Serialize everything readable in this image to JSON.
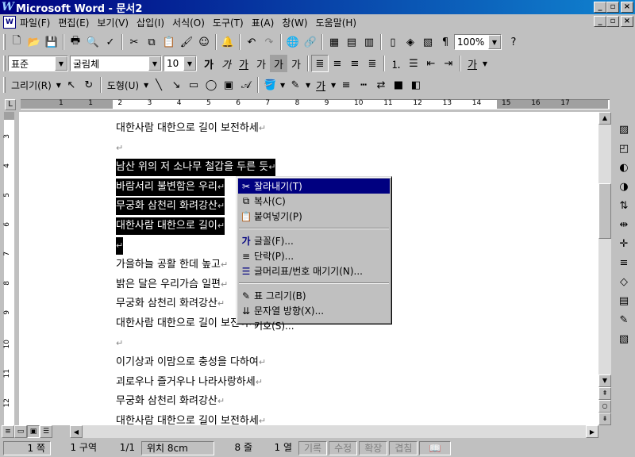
{
  "window": {
    "title": "Microsoft Word - 문서2",
    "minimize": "_",
    "restore": "▫",
    "close": "×"
  },
  "menu": [
    "파일(F)",
    "편집(E)",
    "보기(V)",
    "삽입(I)",
    "서식(O)",
    "도구(T)",
    "표(A)",
    "창(W)",
    "도움말(H)"
  ],
  "standard_toolbar": {
    "zoom": "100%"
  },
  "format_toolbar": {
    "style": "표준",
    "font": "굴림체",
    "size": "10"
  },
  "drawing_toolbar": {
    "draw_label": "그리기(R)",
    "autoshape_label": "도형(U)"
  },
  "ruler": {
    "h_numbers": [
      "1",
      "1",
      "2",
      "3",
      "4",
      "5",
      "6",
      "7",
      "8",
      "9",
      "10",
      "11",
      "12",
      "13",
      "14",
      "15",
      "16",
      "17"
    ],
    "v_numbers": [
      "3",
      "4",
      "5",
      "6",
      "7",
      "8",
      "9",
      "10",
      "11",
      "12",
      "13"
    ]
  },
  "document": {
    "lines": [
      {
        "text": "대한사람 대한으로 길이 보전하세",
        "selected": false
      },
      {
        "text": "",
        "selected": false
      },
      {
        "text": "남산 위의 저 소나무 철갑을 두른 듯",
        "selected": true
      },
      {
        "text": "바람서리 불변함은 우리",
        "selected": true
      },
      {
        "text": "무궁화 삼천리 화려강산",
        "selected": true
      },
      {
        "text": "대한사람 대한으로 길이",
        "selected": true
      },
      {
        "text": "",
        "selected": true
      },
      {
        "text": "가을하늘 공활 한데 높고",
        "selected": false
      },
      {
        "text": "밝은 달은 우리가슴 일편",
        "selected": false
      },
      {
        "text": "무궁화 삼천리 화려강산",
        "selected": false
      },
      {
        "text": "대한사람 대한으로 길이 보전하세",
        "selected": false
      },
      {
        "text": "",
        "selected": false
      },
      {
        "text": "이기상과 이맘으로 충성을 다하여",
        "selected": false
      },
      {
        "text": "괴로우나 즐거우나 나라사랑하세",
        "selected": false
      },
      {
        "text": "무궁화 삼천리 화려강산",
        "selected": false
      },
      {
        "text": "대한사람 대한으로 길이 보전하세",
        "selected": false
      }
    ],
    "para_mark": "↵"
  },
  "context_menu": {
    "group1": [
      {
        "label": "잘라내기(T)",
        "icon": "cut-icon"
      },
      {
        "label": "복사(C)",
        "icon": "copy-icon"
      },
      {
        "label": "붙여넣기(P)",
        "icon": "paste-icon"
      }
    ],
    "group2": [
      {
        "label": "글꼴(F)...",
        "icon": "font-icon"
      },
      {
        "label": "단락(P)...",
        "icon": "paragraph-icon"
      },
      {
        "label": "글머리표/번호 매기기(N)...",
        "icon": "bullets-icon"
      }
    ],
    "group3": [
      {
        "label": "표 그리기(B)",
        "icon": "draw-table-icon"
      },
      {
        "label": "문자열 방향(X)...",
        "icon": "text-direction-icon"
      },
      {
        "label": "기호(S)...",
        "icon": ""
      }
    ]
  },
  "status": {
    "page": "1 쪽",
    "section": "1 구역",
    "pages": "1/1",
    "position": "위치 8cm",
    "line": "8 줄",
    "column": "1 열",
    "rec": "기록",
    "trk": "수정",
    "ext": "확장",
    "ovr": "겹침"
  }
}
